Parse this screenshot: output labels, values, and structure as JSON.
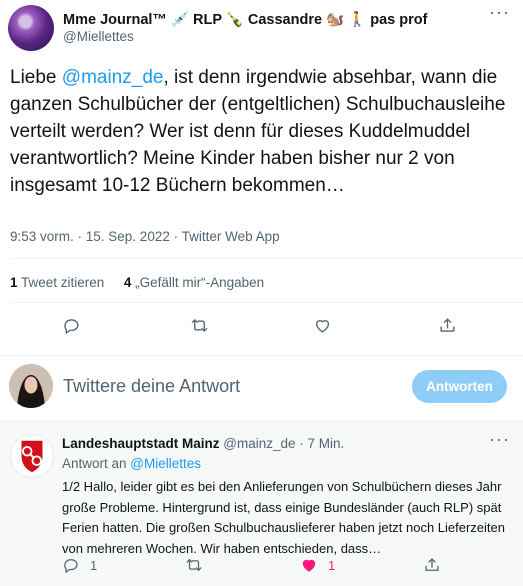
{
  "tweet": {
    "author_name": "Mme Journal™ 💉 RLP 🍾 Cassandre 🐿️ 🚶 pas prof",
    "author_handle": "@Miellettes",
    "text_mention": "@mainz_de",
    "text_before": "Liebe ",
    "text_after": ", ist denn irgendwie absehbar, wann die ganzen Schulbücher der (entgeltlichen) Schulbuchausleihe verteilt werden? Wer ist denn für dieses Kuddelmuddel verantwortlich? Meine Kinder haben bisher nur 2 von insgesamt 10-12 Büchern bekommen…",
    "meta": "9:53 vorm. · 15. Sep. 2022 · Twitter Web App",
    "quote_count": "1",
    "quote_label": "Tweet zitieren",
    "like_count": "4",
    "like_label": "„Gefällt mir“-Angaben",
    "more_icon": "···"
  },
  "reply_box": {
    "placeholder": "Twittere deine Antwort",
    "button_label": "Antworten"
  },
  "reply": {
    "author_name": "Landeshauptstadt Mainz",
    "author_handle": "@mainz_de",
    "separator": " · ",
    "time": "7 Min.",
    "replying_to_prefix": "Antwort an ",
    "replying_to_handle": "@Miellettes",
    "text": "1/2 Hallo, leider gibt es bei den Anlieferungen von Schulbüchern dieses Jahr große Probleme. Hintergrund ist, dass einige Bundesländer (auch RLP) spät Ferien hatten. Die großen Schulbuchauslieferer haben jetzt noch Lieferzeiten von mehreren Wochen. Wir haben entschieden, dass…",
    "reply_count": "1",
    "like_count": "1",
    "more_icon": "···"
  },
  "colors": {
    "accent": "#1d9bf0",
    "like": "#f91880",
    "muted": "#536471",
    "reply_button_disabled": "#8ecdf8"
  }
}
